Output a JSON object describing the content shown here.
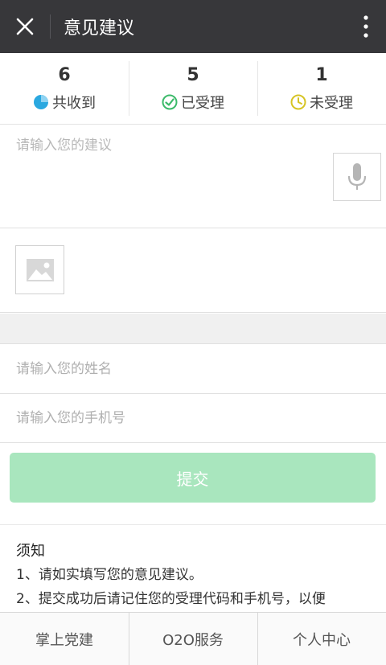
{
  "header": {
    "title": "意见建议",
    "close_icon": "close-icon",
    "more_icon": "more-vertical-icon",
    "background": "#37373a"
  },
  "stats": [
    {
      "count": "6",
      "label": "共收到",
      "icon": "pie-chart-icon",
      "color": "#2aa8e0"
    },
    {
      "count": "5",
      "label": "已受理",
      "icon": "check-circle-icon",
      "color": "#3cba6a"
    },
    {
      "count": "1",
      "label": "未受理",
      "icon": "clock-icon",
      "color": "#d6c424"
    }
  ],
  "suggestion": {
    "placeholder": "请输入您的建议",
    "value": "",
    "mic_icon": "microphone-icon"
  },
  "image_upload": {
    "icon": "image-icon"
  },
  "form": {
    "name_placeholder": "请输入您的姓名",
    "phone_placeholder": "请输入您的手机号",
    "submit_label": "提交",
    "submit_color": "#a9e6be"
  },
  "notice": {
    "title": "须知",
    "lines": [
      "1、请如实填写您的意见建议。",
      "2、提交成功后请记住您的受理代码和手机号，以便"
    ]
  },
  "tabbar": {
    "items": [
      "掌上党建",
      "O2O服务",
      "个人中心"
    ]
  }
}
